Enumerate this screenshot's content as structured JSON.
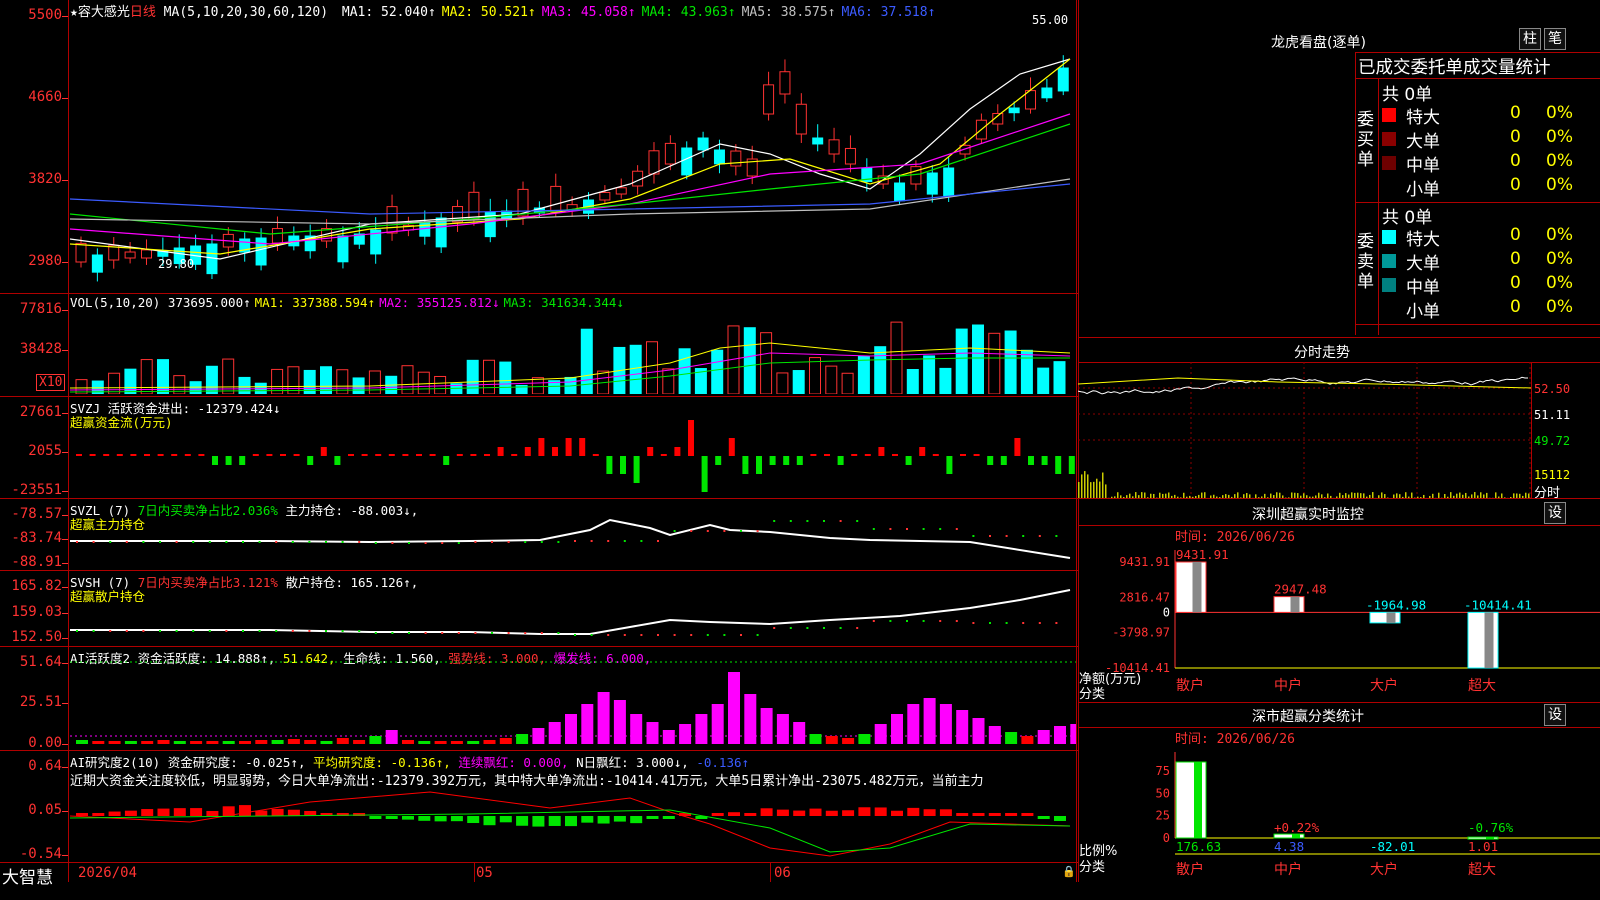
{
  "stock": {
    "name": "★容大感光",
    "period": "日线",
    "ma_label": "MA(5,10,20,30,60,120)",
    "ma": [
      {
        "label": "MA1: 52.040↑",
        "color": "#ffffff"
      },
      {
        "label": "MA2: 50.521↑",
        "color": "#ffff00"
      },
      {
        "label": "MA3: 45.058↑",
        "color": "#ff00ff"
      },
      {
        "label": "MA4: 43.963↑",
        "color": "#00e600"
      },
      {
        "label": "MA5: 38.575↑",
        "color": "#c0c0c0"
      },
      {
        "label": "MA6: 37.518↑",
        "color": "#3b5bff"
      }
    ],
    "high_label": "55.00",
    "low_label": "29.80"
  },
  "price_axis": [
    "5500",
    "4660",
    "3820",
    "2980"
  ],
  "volume": {
    "header_name": "VOL(5,10,20)",
    "header_value": "373695.000↑",
    "ma": [
      {
        "label": "MA1: 337388.594↑",
        "color": "#ffff00"
      },
      {
        "label": "MA2: 355125.812↓",
        "color": "#ff00ff"
      },
      {
        "label": "MA3: 341634.344↓",
        "color": "#00e600"
      }
    ],
    "axis": [
      "77816",
      "38428"
    ],
    "unit": "X10"
  },
  "svzj": {
    "line1": "SVZJ  活跃资金进出: -12379.424↓",
    "line2": "超赢资金流(万元)",
    "axis": [
      "27661",
      "2055",
      "-23551"
    ],
    "values": [
      0,
      0,
      0,
      0,
      0,
      0,
      0,
      0,
      0,
      0,
      -1,
      -1,
      -1,
      0,
      0,
      0,
      0,
      -1,
      1,
      -1,
      0,
      0,
      0,
      0,
      0,
      0,
      0,
      -1,
      0,
      0,
      0,
      1,
      0,
      1,
      2,
      1,
      2,
      2,
      0,
      -2,
      -2,
      -3,
      1,
      0,
      1,
      4,
      -4,
      -1,
      2,
      -2,
      -2,
      -1,
      -1,
      -1,
      0,
      0,
      -1,
      0,
      0,
      1,
      0,
      -1,
      1,
      0,
      -2,
      0,
      0,
      -1,
      -1,
      2,
      -1,
      -1,
      -2,
      -2
    ]
  },
  "svzl": {
    "line1_a": "SVZL (7) ",
    "line1_b": "7日内买卖净占比2.036%",
    "line1_c": " 主力持仓: -88.003↓,",
    "line2": "超赢主力持仓",
    "axis": [
      "-78.57",
      "-83.74",
      "-88.91"
    ]
  },
  "svsh": {
    "line1_a": "SVSH (7) ",
    "line1_b": "7日内买卖净占比3.121%",
    "line1_c": " 散户持仓: 165.126↑,",
    "line2": "超赢散户持仓",
    "axis": [
      "165.82",
      "159.03",
      "152.50"
    ]
  },
  "ai_active": {
    "name": "AI活跃度2",
    "a": "资金活跃度: 14.888↑,",
    "b": "51.642,",
    "c": "生命线: 1.560,",
    "d": "强势线: 3.000,",
    "e": "爆发线: 6.000,",
    "axis": [
      "51.64",
      "25.51",
      "0.00"
    ]
  },
  "ai_research": {
    "name": "AI研究度2(10)",
    "a": "资金研究度: -0.025↑,",
    "b": "平均研究度: -0.136↑,",
    "c": "连续飘红: 0.000,",
    "d": "N日飘红: 3.000↓,",
    "e": "-0.136↑",
    "comment": "近期大资金关注度较低，明显弱势，今日大单净流出:-12379.392万元，其中特大单净流出:-10414.41万元，大单5日累计净出-23075.482万元，当前主力",
    "axis": [
      "0.64",
      "0.05",
      "-0.54"
    ]
  },
  "time_axis": {
    "brand": "大智慧",
    "dates": [
      "2026/04",
      "05",
      "06"
    ]
  },
  "lhb": {
    "title": "龙虎看盘(逐单)",
    "btn1": "柱",
    "btn2": "笔",
    "subtitle": "已成交委托单成交量统计",
    "buy_label": "委买单",
    "sell_label": "委卖单",
    "buy_total": "共 0单",
    "sell_total": "共 0单",
    "buy_rows": [
      {
        "name": "特大",
        "count": "0",
        "pct": "0%",
        "color": "#ff0000"
      },
      {
        "name": "大单",
        "count": "0",
        "pct": "0%",
        "color": "#8b0000"
      },
      {
        "name": "中单",
        "count": "0",
        "pct": "0%",
        "color": "#6e0000"
      },
      {
        "name": "小单",
        "count": "0",
        "pct": "0%",
        "color": "#000000"
      }
    ],
    "sell_rows": [
      {
        "name": "特大",
        "count": "0",
        "pct": "0%",
        "color": "#00ffff"
      },
      {
        "name": "大单",
        "count": "0",
        "pct": "0%",
        "color": "#009999"
      },
      {
        "name": "中单",
        "count": "0",
        "pct": "0%",
        "color": "#008080"
      },
      {
        "name": "小单",
        "count": "0",
        "pct": "0%",
        "color": "#000000"
      }
    ]
  },
  "intraday": {
    "title": "分时走势",
    "axis": [
      "52.50",
      "51.11",
      "49.72",
      "15112",
      "分时"
    ]
  },
  "sz_monitor": {
    "title": "深圳超赢实时监控",
    "btn": "设",
    "time": "时间: 2026/06/26",
    "axis": [
      "9431.91",
      "2816.47",
      "0",
      "-3798.97",
      "-10414.41"
    ],
    "ylabel_1": "净额(万元)",
    "ylabel_2": "分类",
    "bars": [
      {
        "category": "散户",
        "value": 9431.91,
        "label": "9431.91"
      },
      {
        "category": "中户",
        "value": 2947.48,
        "label": "2947.48"
      },
      {
        "category": "大户",
        "value": -1964.98,
        "label": "-1964.98"
      },
      {
        "category": "超大",
        "value": -10414.41,
        "label": "-10414.41"
      }
    ]
  },
  "sz_class": {
    "title": "深市超赢分类统计",
    "btn": "设",
    "time": "时间: 2026/06/26",
    "axis": [
      "75",
      "50",
      "25",
      "0"
    ],
    "ylabel_1": "比例%",
    "ylabel_2": "分类",
    "items": [
      {
        "category": "散户",
        "value": 176.63,
        "label": "176.63",
        "delta": ""
      },
      {
        "category": "中户",
        "value": 4.38,
        "label": "4.38",
        "delta": "+0.22%"
      },
      {
        "category": "大户",
        "value": -82.01,
        "label": "-82.01",
        "delta": ""
      },
      {
        "category": "超大",
        "value": 1.01,
        "label": "1.01",
        "delta": "-0.76%"
      }
    ]
  },
  "chart_data": [
    {
      "type": "bar",
      "title": "深圳超赢实时监控",
      "categories": [
        "散户",
        "中户",
        "大户",
        "超大"
      ],
      "values": [
        9431.91,
        2947.48,
        -1964.98,
        -10414.41
      ],
      "ylabel": "净额(万元)",
      "xlabel": "分类",
      "ylim": [
        -10414.41,
        9431.91
      ]
    },
    {
      "type": "bar",
      "title": "深市超赢分类统计",
      "categories": [
        "散户",
        "中户",
        "大户",
        "超大"
      ],
      "values": [
        176.63,
        4.38,
        -82.01,
        1.01
      ],
      "ylabel": "比例%",
      "xlabel": "分类",
      "ylim": [
        0,
        75
      ]
    }
  ]
}
